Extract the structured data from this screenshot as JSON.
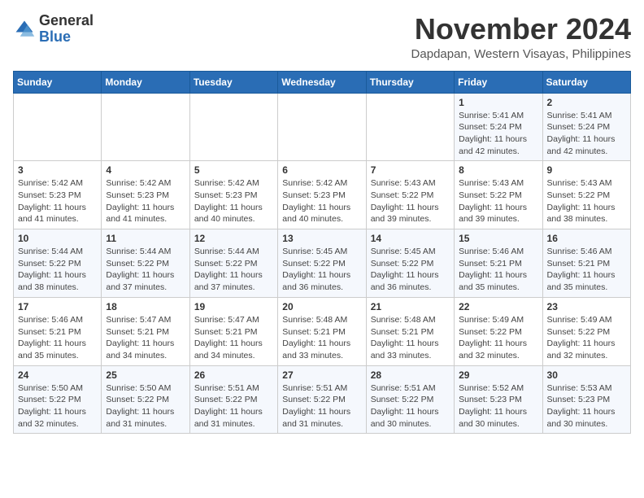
{
  "header": {
    "logo_general": "General",
    "logo_blue": "Blue",
    "month_year": "November 2024",
    "location": "Dapdapan, Western Visayas, Philippines"
  },
  "weekdays": [
    "Sunday",
    "Monday",
    "Tuesday",
    "Wednesday",
    "Thursday",
    "Friday",
    "Saturday"
  ],
  "weeks": [
    [
      {
        "day": "",
        "info": ""
      },
      {
        "day": "",
        "info": ""
      },
      {
        "day": "",
        "info": ""
      },
      {
        "day": "",
        "info": ""
      },
      {
        "day": "",
        "info": ""
      },
      {
        "day": "1",
        "info": "Sunrise: 5:41 AM\nSunset: 5:24 PM\nDaylight: 11 hours and 42 minutes."
      },
      {
        "day": "2",
        "info": "Sunrise: 5:41 AM\nSunset: 5:24 PM\nDaylight: 11 hours and 42 minutes."
      }
    ],
    [
      {
        "day": "3",
        "info": "Sunrise: 5:42 AM\nSunset: 5:23 PM\nDaylight: 11 hours and 41 minutes."
      },
      {
        "day": "4",
        "info": "Sunrise: 5:42 AM\nSunset: 5:23 PM\nDaylight: 11 hours and 41 minutes."
      },
      {
        "day": "5",
        "info": "Sunrise: 5:42 AM\nSunset: 5:23 PM\nDaylight: 11 hours and 40 minutes."
      },
      {
        "day": "6",
        "info": "Sunrise: 5:42 AM\nSunset: 5:23 PM\nDaylight: 11 hours and 40 minutes."
      },
      {
        "day": "7",
        "info": "Sunrise: 5:43 AM\nSunset: 5:22 PM\nDaylight: 11 hours and 39 minutes."
      },
      {
        "day": "8",
        "info": "Sunrise: 5:43 AM\nSunset: 5:22 PM\nDaylight: 11 hours and 39 minutes."
      },
      {
        "day": "9",
        "info": "Sunrise: 5:43 AM\nSunset: 5:22 PM\nDaylight: 11 hours and 38 minutes."
      }
    ],
    [
      {
        "day": "10",
        "info": "Sunrise: 5:44 AM\nSunset: 5:22 PM\nDaylight: 11 hours and 38 minutes."
      },
      {
        "day": "11",
        "info": "Sunrise: 5:44 AM\nSunset: 5:22 PM\nDaylight: 11 hours and 37 minutes."
      },
      {
        "day": "12",
        "info": "Sunrise: 5:44 AM\nSunset: 5:22 PM\nDaylight: 11 hours and 37 minutes."
      },
      {
        "day": "13",
        "info": "Sunrise: 5:45 AM\nSunset: 5:22 PM\nDaylight: 11 hours and 36 minutes."
      },
      {
        "day": "14",
        "info": "Sunrise: 5:45 AM\nSunset: 5:22 PM\nDaylight: 11 hours and 36 minutes."
      },
      {
        "day": "15",
        "info": "Sunrise: 5:46 AM\nSunset: 5:21 PM\nDaylight: 11 hours and 35 minutes."
      },
      {
        "day": "16",
        "info": "Sunrise: 5:46 AM\nSunset: 5:21 PM\nDaylight: 11 hours and 35 minutes."
      }
    ],
    [
      {
        "day": "17",
        "info": "Sunrise: 5:46 AM\nSunset: 5:21 PM\nDaylight: 11 hours and 35 minutes."
      },
      {
        "day": "18",
        "info": "Sunrise: 5:47 AM\nSunset: 5:21 PM\nDaylight: 11 hours and 34 minutes."
      },
      {
        "day": "19",
        "info": "Sunrise: 5:47 AM\nSunset: 5:21 PM\nDaylight: 11 hours and 34 minutes."
      },
      {
        "day": "20",
        "info": "Sunrise: 5:48 AM\nSunset: 5:21 PM\nDaylight: 11 hours and 33 minutes."
      },
      {
        "day": "21",
        "info": "Sunrise: 5:48 AM\nSunset: 5:21 PM\nDaylight: 11 hours and 33 minutes."
      },
      {
        "day": "22",
        "info": "Sunrise: 5:49 AM\nSunset: 5:22 PM\nDaylight: 11 hours and 32 minutes."
      },
      {
        "day": "23",
        "info": "Sunrise: 5:49 AM\nSunset: 5:22 PM\nDaylight: 11 hours and 32 minutes."
      }
    ],
    [
      {
        "day": "24",
        "info": "Sunrise: 5:50 AM\nSunset: 5:22 PM\nDaylight: 11 hours and 32 minutes."
      },
      {
        "day": "25",
        "info": "Sunrise: 5:50 AM\nSunset: 5:22 PM\nDaylight: 11 hours and 31 minutes."
      },
      {
        "day": "26",
        "info": "Sunrise: 5:51 AM\nSunset: 5:22 PM\nDaylight: 11 hours and 31 minutes."
      },
      {
        "day": "27",
        "info": "Sunrise: 5:51 AM\nSunset: 5:22 PM\nDaylight: 11 hours and 31 minutes."
      },
      {
        "day": "28",
        "info": "Sunrise: 5:51 AM\nSunset: 5:22 PM\nDaylight: 11 hours and 30 minutes."
      },
      {
        "day": "29",
        "info": "Sunrise: 5:52 AM\nSunset: 5:23 PM\nDaylight: 11 hours and 30 minutes."
      },
      {
        "day": "30",
        "info": "Sunrise: 5:53 AM\nSunset: 5:23 PM\nDaylight: 11 hours and 30 minutes."
      }
    ]
  ]
}
